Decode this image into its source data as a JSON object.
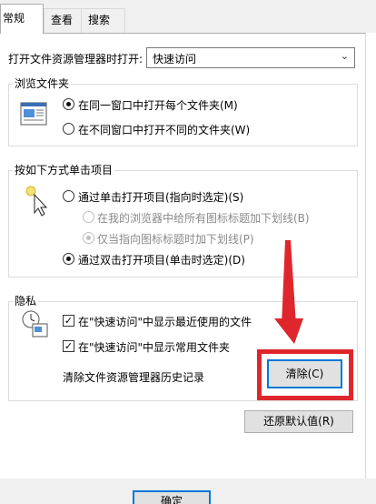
{
  "tabs": [
    {
      "label": "常规"
    },
    {
      "label": "查看"
    },
    {
      "label": "搜索"
    }
  ],
  "open_explorer": {
    "label": "打开文件资源管理器时打开:",
    "value": "快速访问"
  },
  "browse_folders": {
    "title": "浏览文件夹",
    "option_same": "在同一窗口中打开每个文件夹(M)",
    "option_new": "在不同窗口中打开不同的文件夹(W)"
  },
  "click_items": {
    "title": "按如下方式单击项目",
    "option_single": "通过单击打开项目(指向时选定)(S)",
    "sub_underline_all": "在我的浏览器中给所有图标标题加下划线(B)",
    "sub_underline_point": "仅当指向图标标题时加下划线(P)",
    "option_double": "通过双击打开项目(单击时选定)(D)"
  },
  "privacy": {
    "title": "隐私",
    "show_recent": "在\"快速访问\"中显示最近使用的文件",
    "show_frequent": "在\"快速访问\"中显示常用文件夹",
    "clear_label": "清除文件资源管理器历史记录",
    "clear_button": "清除(C)"
  },
  "restore_button": "还原默认值(R)",
  "ok_button": "确定",
  "colors": {
    "highlight": "#e0262d",
    "focus": "#0078d7"
  }
}
